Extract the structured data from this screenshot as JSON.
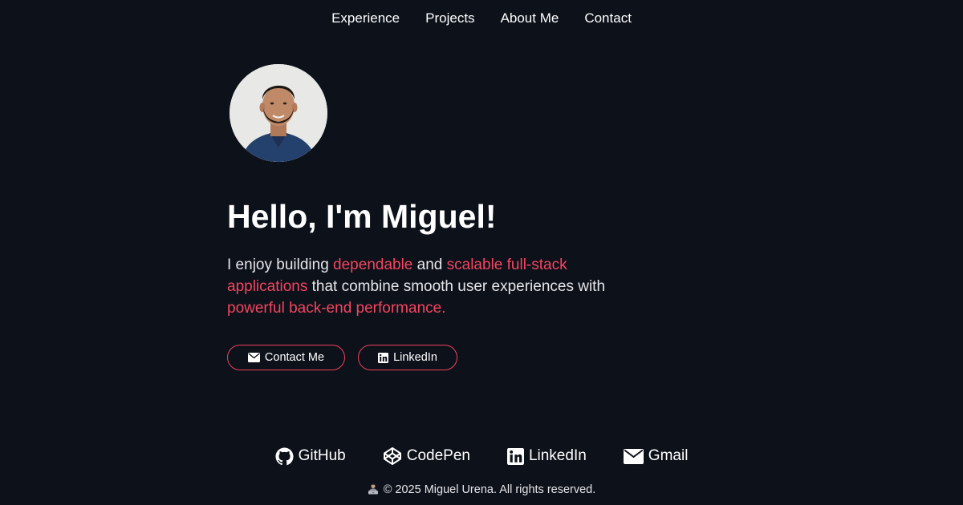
{
  "nav": {
    "items": [
      {
        "label": "Experience"
      },
      {
        "label": "Projects"
      },
      {
        "label": "About Me"
      },
      {
        "label": "Contact"
      }
    ]
  },
  "hero": {
    "title": "Hello, I'm Miguel!",
    "intro": {
      "p1": "I enjoy building ",
      "h1": "dependable",
      "p2": " and ",
      "h2": "scalable full-stack applications",
      "p3": " that combine smooth user experiences with ",
      "h3": "powerful back-end performance."
    },
    "contact_button": "Contact Me",
    "linkedin_button": "LinkedIn"
  },
  "footer": {
    "links": [
      {
        "label": "GitHub",
        "icon": "github-icon"
      },
      {
        "label": "CodePen",
        "icon": "codepen-icon"
      },
      {
        "label": "LinkedIn",
        "icon": "linkedin-icon"
      },
      {
        "label": "Gmail",
        "icon": "mail-icon"
      }
    ],
    "copyright": "© 2025 Miguel Urena. All rights reserved."
  },
  "colors": {
    "background": "#0c111a",
    "accent": "#f4455f",
    "text": "#ffffff"
  }
}
